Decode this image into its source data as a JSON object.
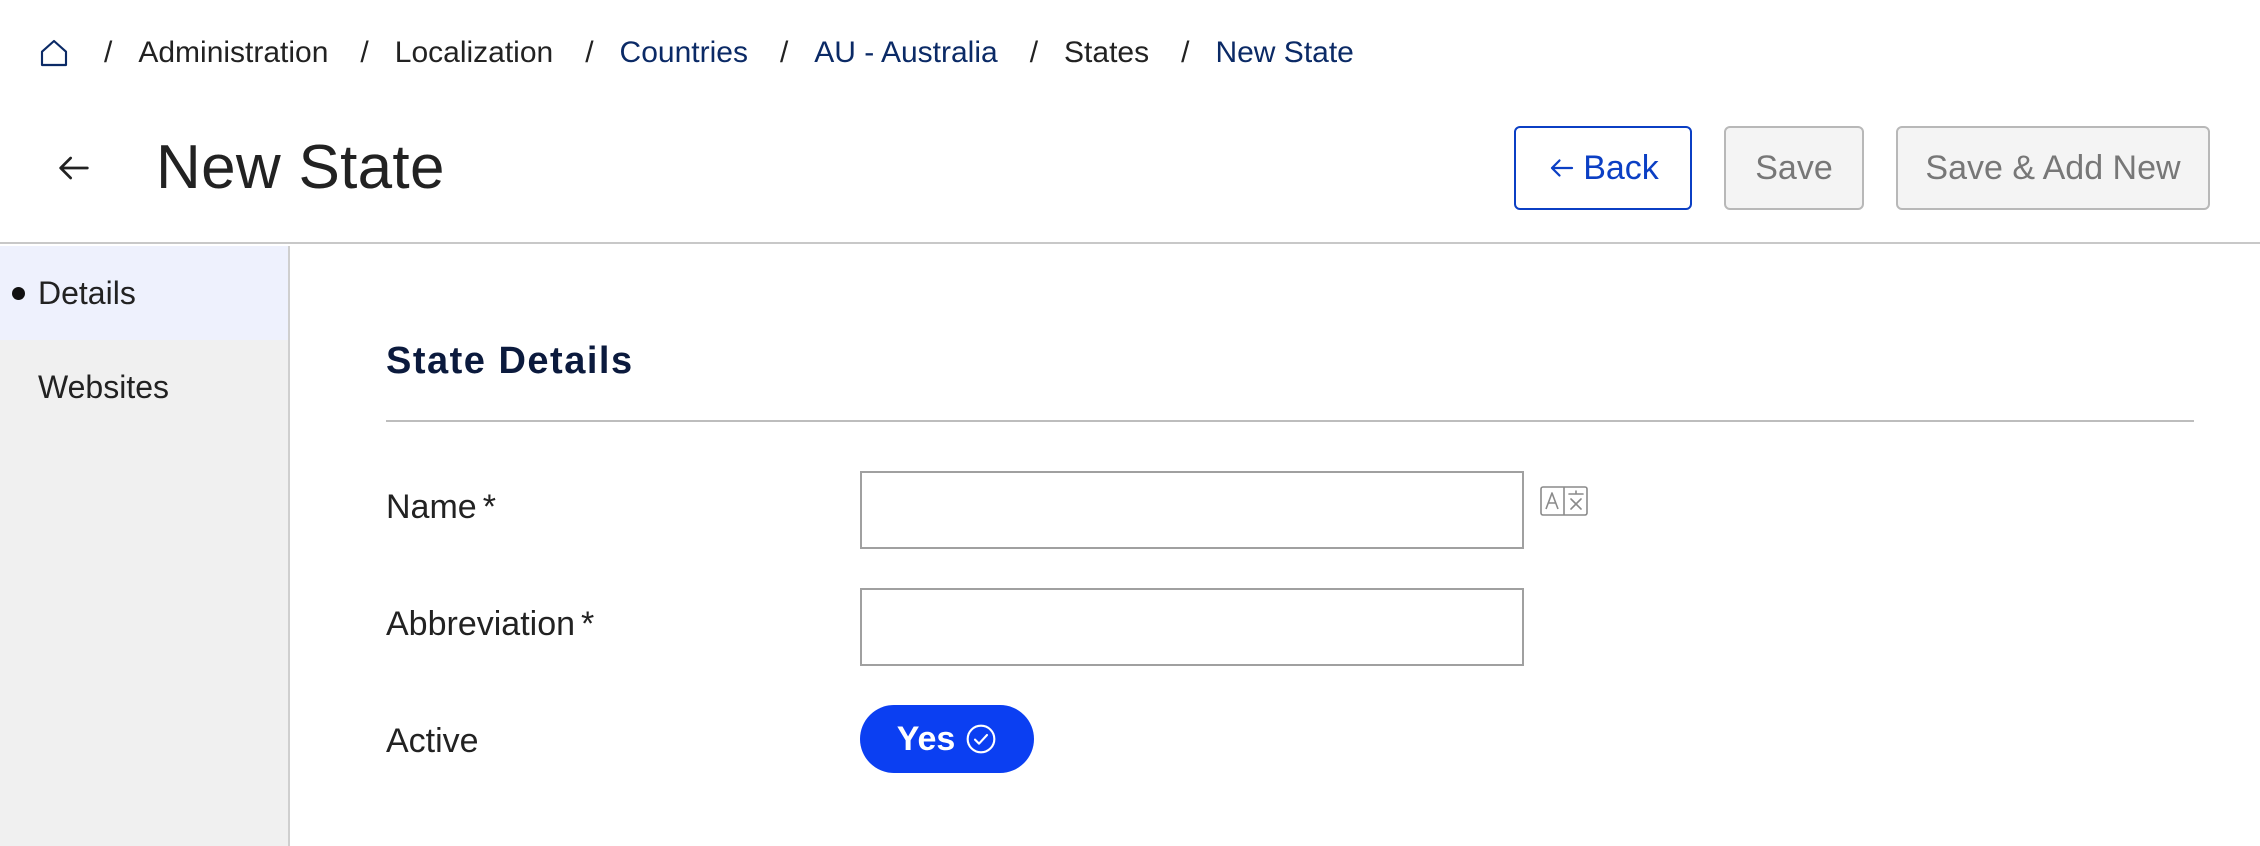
{
  "breadcrumb": {
    "items": [
      {
        "label": "Administration",
        "link": false
      },
      {
        "label": "Localization",
        "link": false
      },
      {
        "label": "Countries",
        "link": true
      },
      {
        "label": "AU - Australia",
        "link": true
      },
      {
        "label": "States",
        "link": false
      },
      {
        "label": "New State",
        "link": true
      }
    ],
    "separator": "/"
  },
  "header": {
    "title": "New State",
    "back_label": "Back",
    "save_label": "Save",
    "save_add_label": "Save & Add New"
  },
  "sidebar": {
    "items": [
      {
        "label": "Details",
        "active": true
      },
      {
        "label": "Websites",
        "active": false
      }
    ]
  },
  "form": {
    "section_title": "State Details",
    "name": {
      "label": "Name",
      "required_mark": "*",
      "value": ""
    },
    "abbreviation": {
      "label": "Abbreviation",
      "required_mark": "*",
      "value": ""
    },
    "active": {
      "label": "Active",
      "toggle_label": "Yes"
    }
  },
  "colors": {
    "primary": "#0b3ff2",
    "link": "#0b2a66",
    "back_button": "#0b3fc4",
    "sidebar_bg": "#f0f0f0",
    "sidebar_active_bg": "#eef1fd"
  },
  "icons": {
    "home": "home-icon",
    "back": "arrow-left-icon",
    "translate": "translate-icon",
    "check": "check-circle-icon"
  }
}
